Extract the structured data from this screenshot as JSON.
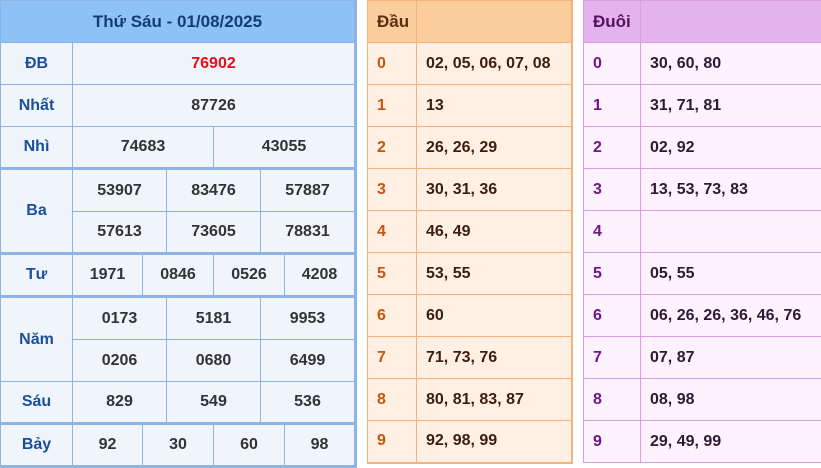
{
  "results": {
    "date_title": "Thứ Sáu - 01/08/2025",
    "rows": {
      "db": {
        "label": "ĐB",
        "values": [
          "76902"
        ]
      },
      "nhat": {
        "label": "Nhất",
        "values": [
          "87726"
        ]
      },
      "nhi": {
        "label": "Nhì",
        "values": [
          "74683",
          "43055"
        ]
      },
      "ba": {
        "label": "Ba",
        "values": [
          "53907",
          "83476",
          "57887",
          "57613",
          "73605",
          "78831"
        ]
      },
      "tu": {
        "label": "Tư",
        "values": [
          "1971",
          "0846",
          "0526",
          "4208"
        ]
      },
      "nam": {
        "label": "Năm",
        "values": [
          "0173",
          "5181",
          "9953",
          "0206",
          "0680",
          "6499"
        ]
      },
      "sau": {
        "label": "Sáu",
        "values": [
          "829",
          "549",
          "536"
        ]
      },
      "bay": {
        "label": "Bảy",
        "values": [
          "92",
          "30",
          "60",
          "98"
        ]
      }
    },
    "colors": {
      "special_prize": "#e3101a",
      "header_bg": "#8ec2f7"
    }
  },
  "dau": {
    "header": "Đầu",
    "rows": [
      {
        "num": "0",
        "vals": "02, 05, 06, 07, 08"
      },
      {
        "num": "1",
        "vals": "13"
      },
      {
        "num": "2",
        "vals": "26, 26, 29"
      },
      {
        "num": "3",
        "vals": "30, 31, 36"
      },
      {
        "num": "4",
        "vals": "46, 49"
      },
      {
        "num": "5",
        "vals": "53, 55"
      },
      {
        "num": "6",
        "vals": "60"
      },
      {
        "num": "7",
        "vals": "71, 73, 76"
      },
      {
        "num": "8",
        "vals": "80, 81, 83, 87"
      },
      {
        "num": "9",
        "vals": "92, 98, 99"
      }
    ]
  },
  "duoi": {
    "header": "Đuôi",
    "rows": [
      {
        "num": "0",
        "vals": "30, 60, 80"
      },
      {
        "num": "1",
        "vals": "31, 71, 81"
      },
      {
        "num": "2",
        "vals": "02, 92"
      },
      {
        "num": "3",
        "vals": "13, 53, 73, 83"
      },
      {
        "num": "4",
        "vals": ""
      },
      {
        "num": "5",
        "vals": "05, 55"
      },
      {
        "num": "6",
        "vals": "06, 26, 26, 36, 46, 76"
      },
      {
        "num": "7",
        "vals": "07, 87"
      },
      {
        "num": "8",
        "vals": "08, 98"
      },
      {
        "num": "9",
        "vals": "29, 49, 99"
      }
    ]
  }
}
